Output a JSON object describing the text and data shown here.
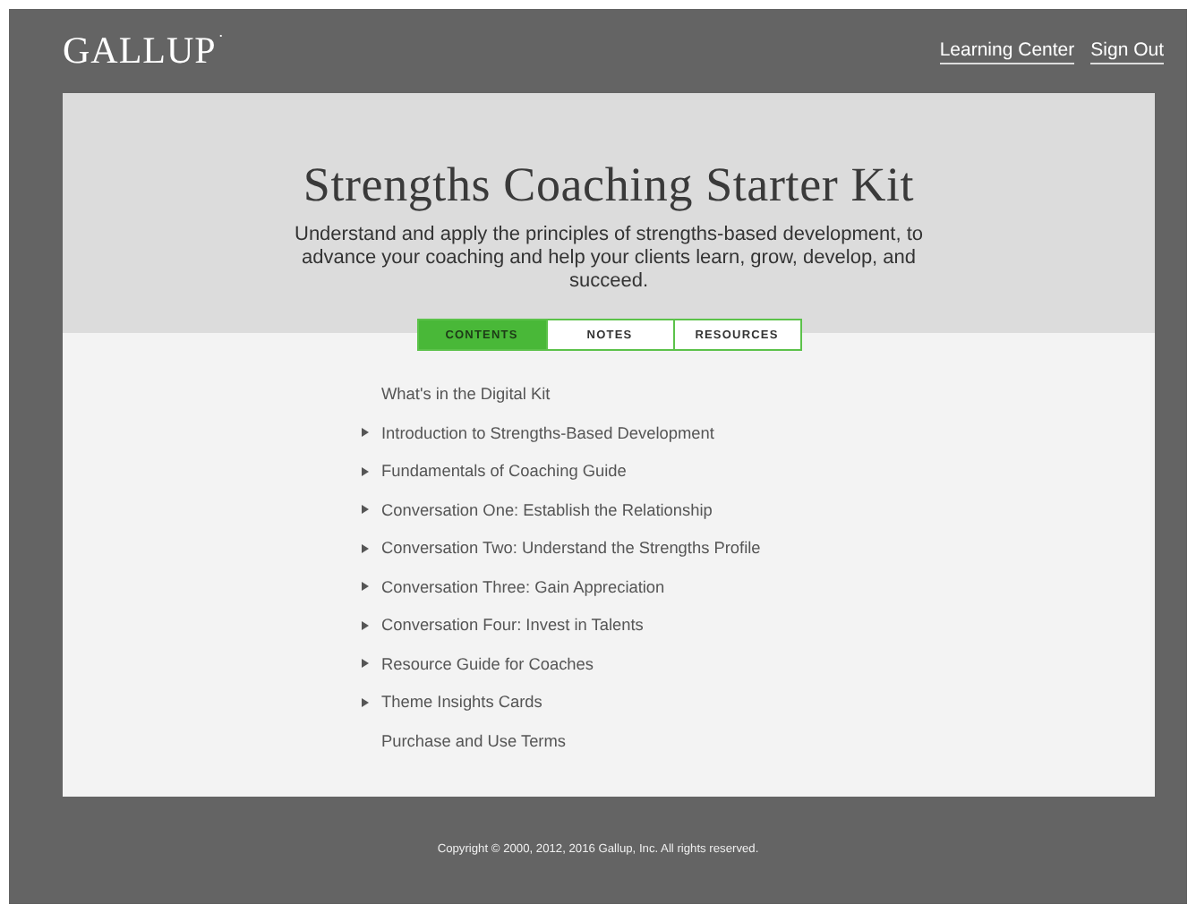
{
  "header": {
    "logo": "GALLUP",
    "logo_mark": "·",
    "links": [
      "Learning Center",
      "Sign Out"
    ]
  },
  "hero": {
    "title": "Strengths Coaching Starter Kit",
    "subtitle": "Understand and apply the principles of strengths-based development, to advance your coaching and help your clients learn, grow, develop, and succeed."
  },
  "tabs": [
    {
      "label": "CONTENTS",
      "selected": true
    },
    {
      "label": "NOTES",
      "selected": false
    },
    {
      "label": "RESOURCES",
      "selected": false
    }
  ],
  "contents": [
    {
      "label": "What's in the Digital Kit",
      "kind": "link"
    },
    {
      "label": "Introduction to Strengths-Based Development",
      "kind": "section"
    },
    {
      "label": "Fundamentals of Coaching Guide",
      "kind": "section"
    },
    {
      "label": "Conversation One: Establish the Relationship",
      "kind": "section"
    },
    {
      "label": "Conversation Two: Understand the Strengths Profile",
      "kind": "section"
    },
    {
      "label": "Conversation Three: Gain Appreciation",
      "kind": "section"
    },
    {
      "label": "Conversation Four: Invest in Talents",
      "kind": "section"
    },
    {
      "label": "Resource Guide for Coaches",
      "kind": "section"
    },
    {
      "label": "Theme Insights Cards",
      "kind": "section"
    },
    {
      "label": "Purchase and Use Terms",
      "kind": "link"
    }
  ],
  "footer": {
    "copyright": "Copyright © 2000, 2012, 2016 Gallup, Inc. All rights reserved."
  }
}
